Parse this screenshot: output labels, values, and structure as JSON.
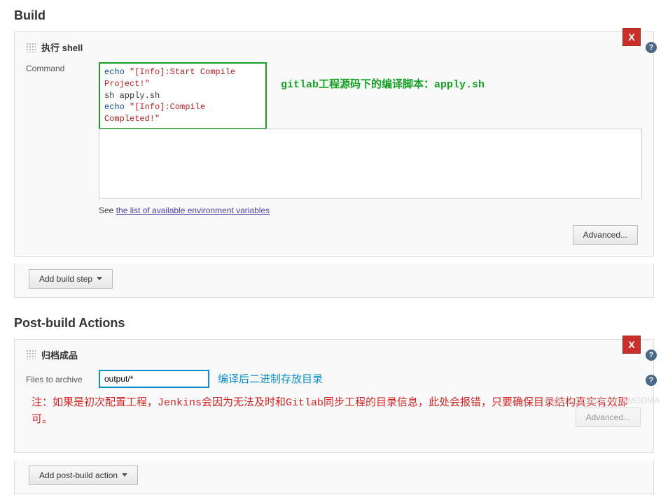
{
  "build": {
    "title": "Build",
    "shell_panel": {
      "title": "执行 shell",
      "command_label": "Command",
      "code": {
        "l1a": "echo ",
        "l1b": "\"[Info]:Start Compile Project!\"",
        "l2": "sh apply.sh",
        "l3a": "echo ",
        "l3b": "\"[Info]:Compile Completed!\""
      },
      "annotation": "gitlab工程源码下的编译脚本：apply.sh",
      "see_prefix": "See ",
      "see_link": "the list of available environment variables",
      "advanced": "Advanced..."
    },
    "add_step": "Add build step"
  },
  "post": {
    "title": "Post-build Actions",
    "archive_panel": {
      "title": "归档成品",
      "files_label": "Files to archive",
      "files_value": "output/*",
      "annotation_blue": "编译后二进制存放目录",
      "annotation_red": "注：如果是初次配置工程，Jenkins会因为无法及时和Gitlab同步工程的目录信息，此处会报错，只要确保目录结构真实有效即可。",
      "advanced": "Advanced..."
    },
    "add_action": "Add post-build action"
  },
  "ui": {
    "close": "X",
    "help": "?"
  },
  "watermark": "https://blog.csdn.net/AMDDMA"
}
